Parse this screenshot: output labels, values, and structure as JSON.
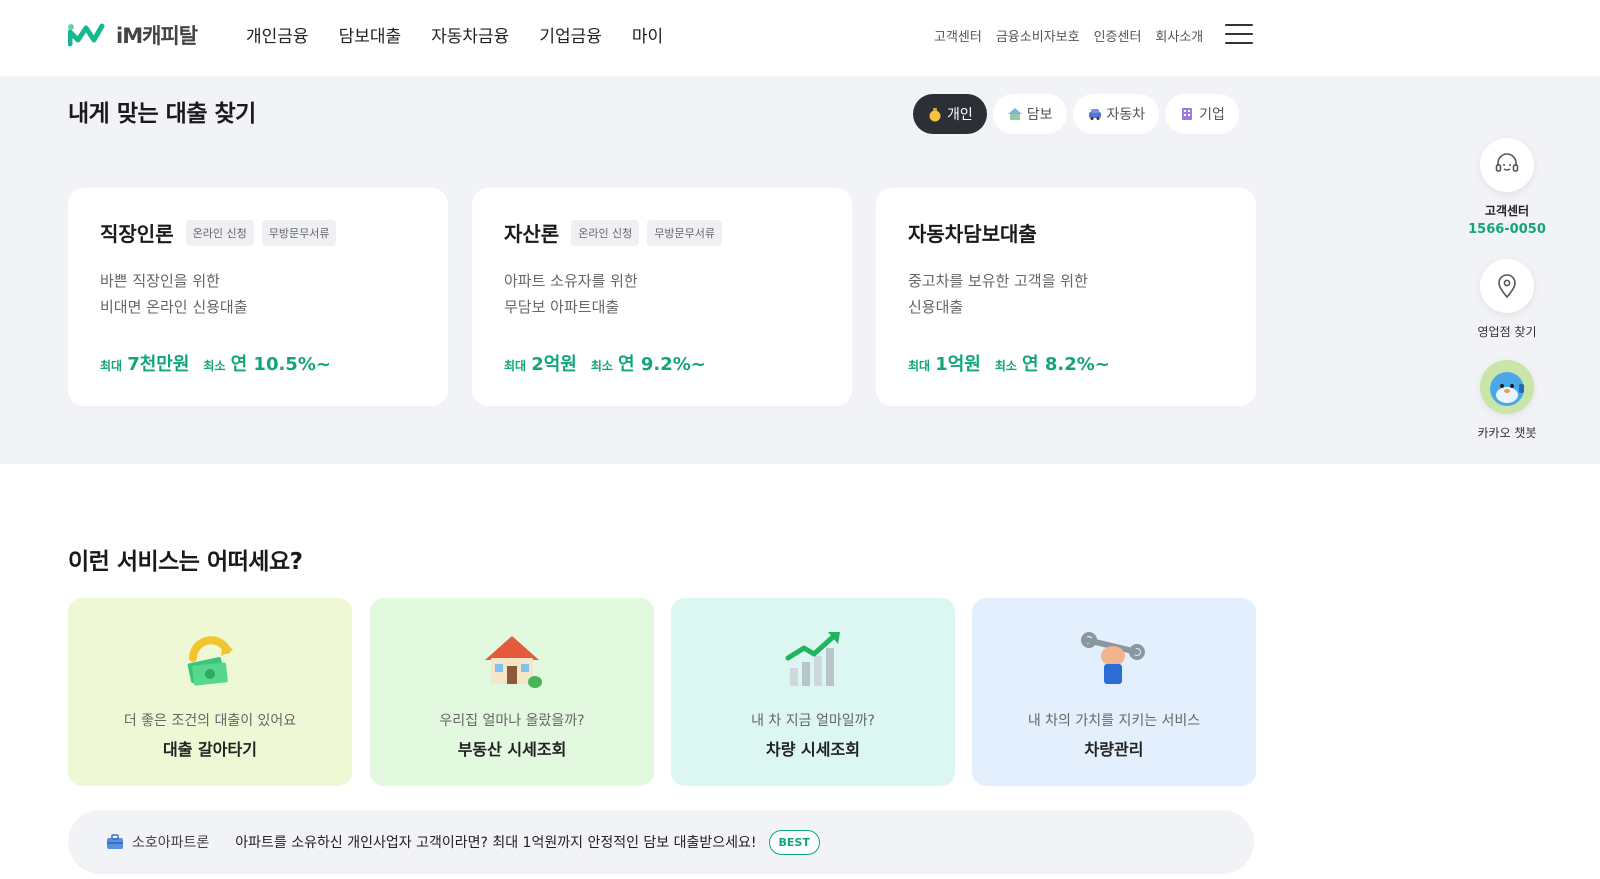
{
  "header": {
    "logo_text": "iM캐피탈",
    "nav": [
      "개인금융",
      "담보대출",
      "자동차금융",
      "기업금융",
      "마이"
    ],
    "util": [
      "고객센터",
      "금융소비자보호",
      "인증센터",
      "회사소개"
    ]
  },
  "finder": {
    "title": "내게 맞는 대출 찾기",
    "tabs": [
      {
        "label": "개인",
        "icon": "money-bag-icon",
        "active": true
      },
      {
        "label": "담보",
        "icon": "house-icon",
        "active": false
      },
      {
        "label": "자동차",
        "icon": "car-icon",
        "active": false
      },
      {
        "label": "기업",
        "icon": "building-icon",
        "active": false
      }
    ],
    "cards": [
      {
        "name": "직장인론",
        "tags": [
          "온라인 신청",
          "무방문무서류"
        ],
        "desc": [
          "바쁜 직장인을 위한",
          "비대면 온라인 신용대출"
        ],
        "limit_label": "최대",
        "limit_value": "7천만원",
        "rate_label": "최소",
        "rate_value": "연 10.5%~"
      },
      {
        "name": "자산론",
        "tags": [
          "온라인 신청",
          "무방문무서류"
        ],
        "desc": [
          "아파트 소유자를 위한",
          "무담보 아파트대출"
        ],
        "limit_label": "최대",
        "limit_value": "2억원",
        "rate_label": "최소",
        "rate_value": "연 9.2%~"
      },
      {
        "name": "자동차담보대출",
        "tags": [],
        "desc": [
          "중고차를 보유한 고객을 위한",
          "신용대출"
        ],
        "limit_label": "최대",
        "limit_value": "1억원",
        "rate_label": "최소",
        "rate_value": "연 8.2%~"
      }
    ]
  },
  "quick": {
    "support_label": "고객센터",
    "support_phone": "1566-0050",
    "branch_label": "영업점 찾기",
    "chatbot_label": "카카오 챗봇"
  },
  "services": {
    "title": "이런 서비스는 어떠세요?",
    "cards": [
      {
        "sub": "더 좋은 조건의 대출이 있어요",
        "name": "대출 갈아타기",
        "bg": "#eef8d4",
        "icon": "money-swap-icon"
      },
      {
        "sub": "우리집 얼마나 올랐을까?",
        "name": "부동산 시세조회",
        "bg": "#e2f8df",
        "icon": "house-icon"
      },
      {
        "sub": "내 차 지금 얼마일까?",
        "name": "차량 시세조회",
        "bg": "#dcf6f1",
        "icon": "growth-chart-icon"
      },
      {
        "sub": "내 차의 가치를 지키는 서비스",
        "name": "차량관리",
        "bg": "#e3effd",
        "icon": "wrench-icon"
      }
    ]
  },
  "banner": {
    "label": "소호아파트론",
    "text": "아파트를 소유하신 개인사업자 고객이라면? 최대 1억원까지 안정적인 담보 대출받으세요!",
    "badge": "BEST"
  },
  "colors": {
    "accent": "#12a57c",
    "dark": "#2b2f36",
    "section_bg": "#f2f3f6"
  }
}
